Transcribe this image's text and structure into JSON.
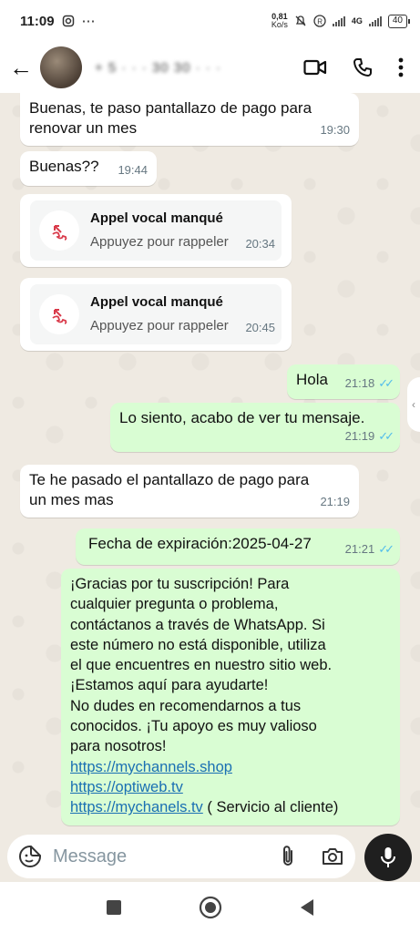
{
  "status_bar": {
    "time": "11:09",
    "speed_value": "0,81",
    "speed_unit": "Ko/s",
    "network": "4G",
    "battery": "40"
  },
  "header": {
    "contact_name": "+ 5 · · · 30 30 · · ·"
  },
  "messages": {
    "m1": {
      "text_line1": "Buenas, te paso pantallazo de pago para",
      "text_line2": "renovar un mes",
      "time": "19:30"
    },
    "m2": {
      "text": "Buenas??",
      "time": "19:44"
    },
    "call1": {
      "title": "Appel vocal manqué",
      "subtitle": "Appuyez pour rappeler",
      "time": "20:34"
    },
    "call2": {
      "title": "Appel vocal manqué",
      "subtitle": "Appuyez pour rappeler",
      "time": "20:45"
    },
    "m3": {
      "text": "Hola",
      "time": "21:18"
    },
    "m4": {
      "text": "Lo siento, acabo de ver tu mensaje.",
      "time": "21:19"
    },
    "m5": {
      "text_line1": "Te he pasado el pantallazo de pago para",
      "text_line2": "un mes mas",
      "time": "21:19"
    },
    "m6": {
      "text": "Fecha de expiración:2025-04-27",
      "time": "21:21"
    },
    "m7": {
      "lines": [
        "¡Gracias por tu suscripción! Para",
        "cualquier pregunta o problema,",
        "contáctanos a través de WhatsApp. Si",
        "este número no está disponible, utiliza",
        "el que encuentres en nuestro sitio web.",
        "¡Estamos aquí para ayudarte!",
        "No dudes en recomendarnos a tus",
        "conocidos. ¡Tu apoyo es muy valioso",
        "para nosotros!"
      ],
      "link1": "https://mychannels.shop",
      "link2": "https://optiweb.tv",
      "link3": "https://mychanels.tv",
      "link3_suffix": " ( Servicio al cliente)"
    }
  },
  "input": {
    "placeholder": "Message"
  },
  "colors": {
    "outgoing_bubble": "#d9fdd3",
    "incoming_bubble": "#ffffff",
    "chat_background": "#efeae2",
    "read_ticks": "#53bdeb",
    "link": "#1a6fb3",
    "missed_call": "#d93b4b"
  },
  "icons": [
    "back-arrow-icon",
    "video-call-icon",
    "voice-call-icon",
    "more-options-icon",
    "missed-call-icon",
    "sticker-icon",
    "attach-icon",
    "camera-icon",
    "mic-icon",
    "nav-recents-icon",
    "nav-home-icon",
    "nav-back-icon"
  ]
}
